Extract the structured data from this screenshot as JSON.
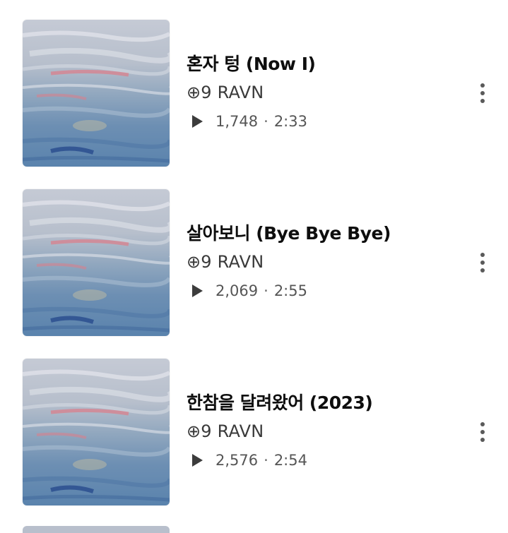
{
  "tracks": [
    {
      "title": "혼자 텅 (Now I)",
      "artist": "⊕9 RAVN",
      "plays": "1,748",
      "separator": "·",
      "duration": "2:33",
      "thumbnail_icon": "album-art-painting",
      "menu_icon": "more-vertical-icon"
    },
    {
      "title": "살아보니 (Bye Bye Bye)",
      "artist": "⊕9 RAVN",
      "plays": "2,069",
      "separator": "·",
      "duration": "2:55",
      "thumbnail_icon": "album-art-painting",
      "menu_icon": "more-vertical-icon"
    },
    {
      "title": "한참을 달려왔어 (2023)",
      "artist": "⊕9 RAVN",
      "plays": "2,576",
      "separator": "·",
      "duration": "2:54",
      "thumbnail_icon": "album-art-painting",
      "menu_icon": "more-vertical-icon"
    }
  ],
  "colors": {
    "title": "#0e0e0e",
    "artist": "#3a3a3a",
    "meta": "#555555",
    "art_sky": "#c7ccd6",
    "art_sea": "#5d84ac",
    "art_deep": "#2c4f8f",
    "art_pink": "#d9808c"
  }
}
